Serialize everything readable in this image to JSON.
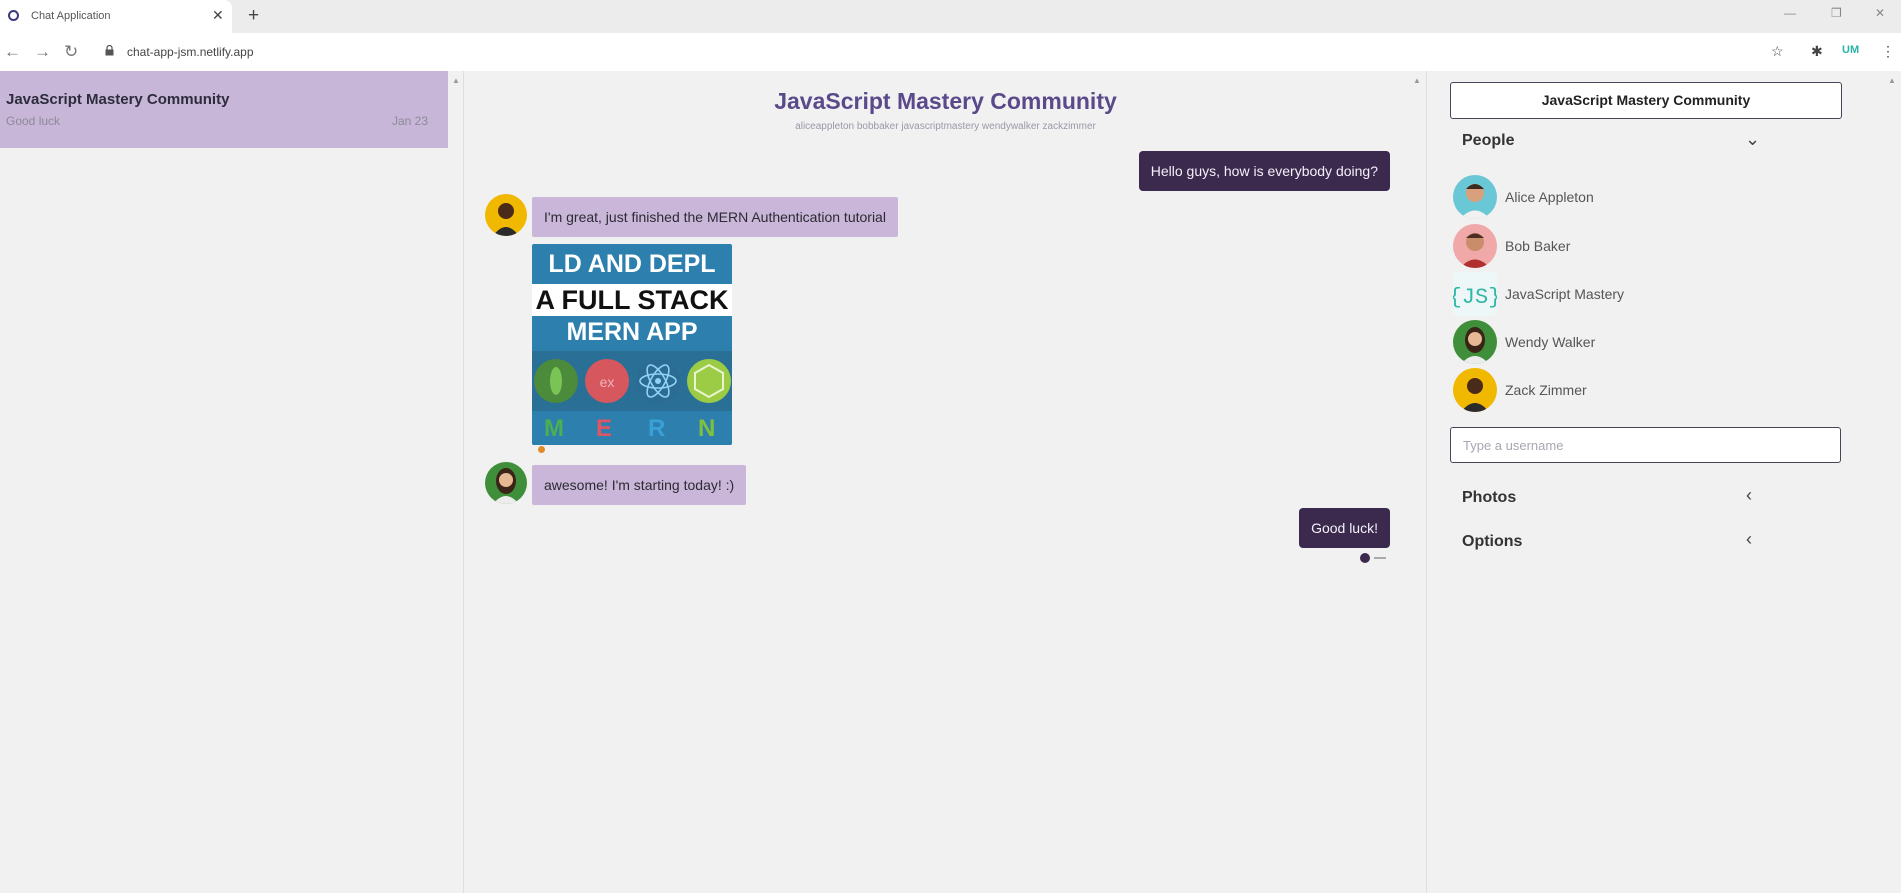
{
  "browser": {
    "tab_title": "Chat Application",
    "url": "chat-app-jsm.netlify.app",
    "profile_initials": "UM"
  },
  "colors": {
    "accent": "#3b2a4e",
    "bubble_in": "#c9b6d8",
    "selected_chat": "#c8b6d8",
    "title": "#5a4a8a"
  },
  "chat_list": [
    {
      "title": "JavaScript Mastery Community",
      "last_message": "Good luck",
      "date": "Jan 23"
    }
  ],
  "chat": {
    "title": "JavaScript Mastery Community",
    "members_line": "aliceappleton bobbaker javascriptmastery wendywalker zackzimmer",
    "messages": [
      {
        "type": "outgoing",
        "text": "Hello guys, how is everybody doing?"
      },
      {
        "type": "incoming",
        "sender": "Zack Zimmer",
        "text": "I'm great, just finished the MERN Authentication tutorial"
      },
      {
        "type": "image",
        "sender": "Zack Zimmer",
        "caption_lines": [
          "LD AND DEPL",
          "A FULL STACK",
          "MERN APP"
        ],
        "footer_letters": [
          "M",
          "E",
          "R",
          "N"
        ]
      },
      {
        "type": "incoming",
        "sender": "Wendy Walker",
        "text": "awesome! I'm starting today! :)"
      },
      {
        "type": "outgoing",
        "text": "Good luck!"
      }
    ]
  },
  "settings": {
    "title": "JavaScript Mastery Community",
    "people_header": "People",
    "people": [
      {
        "name": "Alice Appleton"
      },
      {
        "name": "Bob Baker"
      },
      {
        "name": "JavaScript Mastery"
      },
      {
        "name": "Wendy Walker"
      },
      {
        "name": "Zack Zimmer"
      }
    ],
    "username_placeholder": "Type a username",
    "photos_header": "Photos",
    "options_header": "Options"
  }
}
